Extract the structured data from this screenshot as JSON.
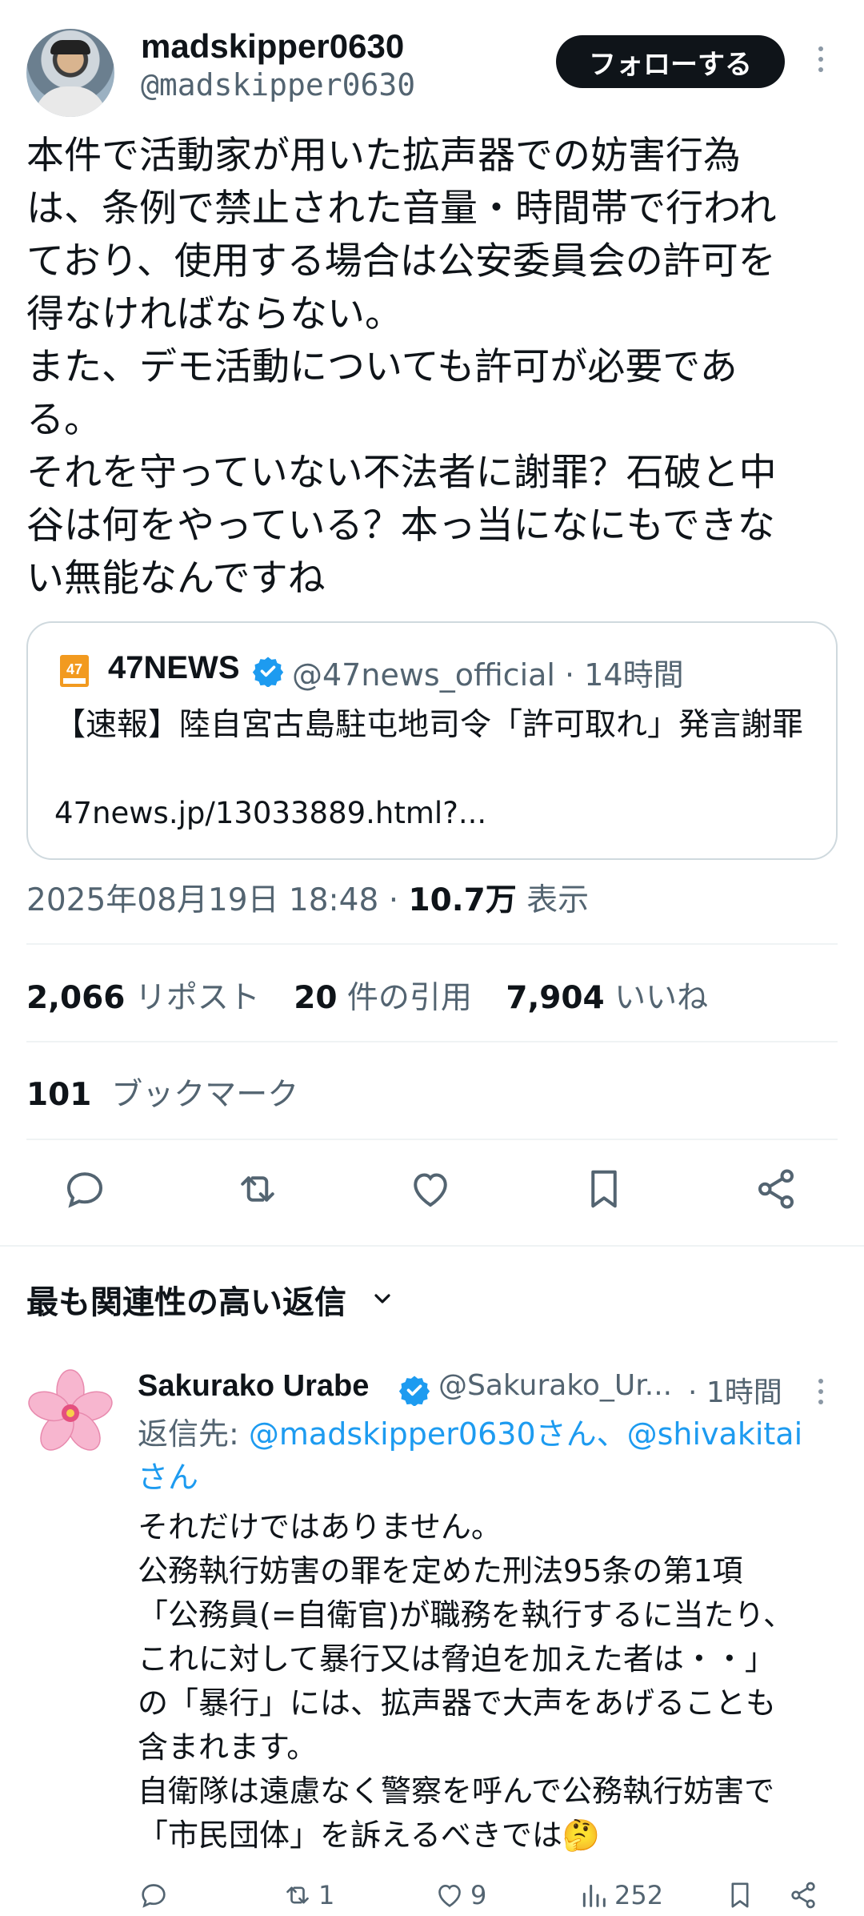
{
  "post": {
    "display_name": "madskipper0630",
    "handle": "@madskipper0630",
    "follow_label": "フォローする",
    "text": "本件で活動家が用いた拡声器での妨害行為\nは、条例で禁止された音量・時間帯で行われ\nており、使用する場合は公安委員会の許可を\n得なければならない。\nまた、デモ活動についても許可が必要であ\nる。\nそれを守っていない不法者に謝罪？石破と中\n谷は何をやっている？本っ当になにもできな\nい無能なんですね"
  },
  "quote": {
    "logo_text": "47",
    "name": "47NEWS",
    "meta": "@47news_official · 14時間",
    "title": "【速報】陸自宮古島駐屯地司令「許可取れ」発言謝罪",
    "link": "47news.jp/13033889.html?..."
  },
  "timestamp": {
    "datetime": "2025年08月19日 18:48 · ",
    "views_value": "10.7万",
    "views_label": " 表示"
  },
  "stats": {
    "reposts_value": "2,066",
    "reposts_label": "リポスト",
    "quotes_value": "20",
    "quotes_label": "件の引用",
    "likes_value": "7,904",
    "likes_label": "いいね",
    "bookmarks_value": "101",
    "bookmarks_label": "ブックマーク"
  },
  "actions": [
    "reply-icon",
    "repost-icon",
    "like-icon",
    "bookmark-icon",
    "share-icon"
  ],
  "replies_header": "最も関連性の高い返信",
  "reply": {
    "display_name": "Sakurako Urabe",
    "handle": "@Sakurako_Ur...",
    "time": "· 1時間",
    "reply_to_prefix": "返信先: ",
    "reply_to_mentions": "@madskipper0630さん、@shivakitai\nさん",
    "text": "それだけではありません。\n公務執行妨害の罪を定めた刑法95条の第1項\n「公務員(=自衛官)が職務を執行するに当たり、\nこれに対して暴行又は脅迫を加えた者は・・」\nの「暴行」には、拡声器で大声をあげることも\n含まれます。\n自衛隊は遠慮なく警察を呼んで公務執行妨害で\n「市民団体」を訴えるべきでは🤔",
    "repost_count": "1",
    "like_count": "9",
    "view_count": "252"
  },
  "colors": {
    "accent": "#1d9bf0",
    "text": "#0f1419",
    "secondary": "#536471",
    "divider": "#eff3f4"
  }
}
